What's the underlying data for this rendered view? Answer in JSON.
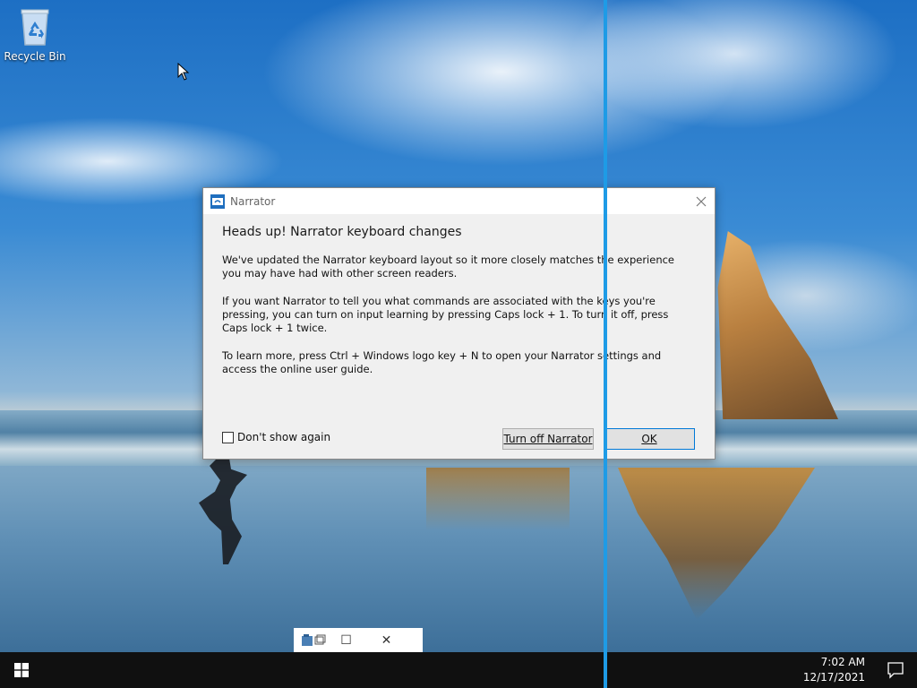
{
  "desktop": {
    "icons": [
      {
        "label": "Recycle Bin",
        "icon": "recycle-bin-icon"
      }
    ]
  },
  "dialog": {
    "app_title": "Narrator",
    "app_icon": "narrator-icon",
    "heading": "Heads up! Narrator keyboard changes",
    "paragraphs": [
      "We've updated the Narrator keyboard layout so it more closely matches the experience you may have had with other screen readers.",
      "If you want Narrator to tell you what commands are associated with the keys you're pressing, you can turn on input learning by pressing Caps lock + 1. To turn it off, press Caps lock + 1 twice.",
      "To learn more, press Ctrl + Windows logo key + N to open your Narrator settings and access the online user guide."
    ],
    "checkbox_label": "Don't show again",
    "checkbox_checked": false,
    "turn_off_label": "Turn off Narrator",
    "ok_label": "OK",
    "close_icon": "close-icon"
  },
  "snap_window_controls": {
    "icons": [
      "app-window-icon",
      "maximize-icon",
      "close-icon"
    ]
  },
  "taskbar": {
    "start_icon": "windows-start-icon",
    "time": "7:02 AM",
    "date": "12/17/2021",
    "notification_icon": "action-center-icon"
  },
  "colors": {
    "snap_divider": "#1e9be6",
    "ok_border": "#0078d7",
    "taskbar": "#101010"
  }
}
